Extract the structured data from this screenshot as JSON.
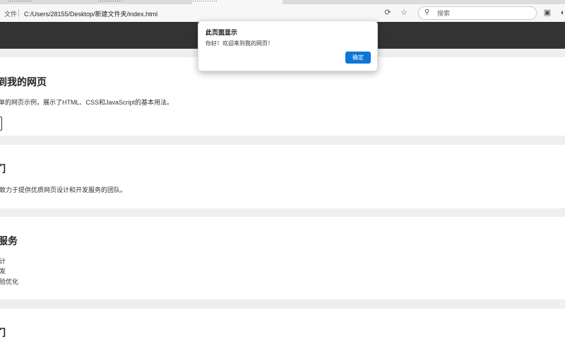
{
  "browser": {
    "tabs": [
      {
        "label": "…………"
      },
      {
        "label": "…………"
      },
      {
        "label": "…………"
      }
    ],
    "file_label": "文件",
    "url": "C:/Users/28155/Desktop/新建文件夹/index.html",
    "search_placeholder": "搜索",
    "icons": {
      "tracking": "tracking-icon",
      "favorite": "star-icon",
      "search": "search-icon",
      "collections": "collections-icon",
      "more": "more-icon"
    }
  },
  "page": {
    "header_color": "#333333",
    "sections": [
      {
        "title": "到我的网页",
        "text": "单的网页示例，展示了HTML、CSS和JavaScript的基本用法。"
      },
      {
        "title": "们",
        "text": "致力于提供优质网页设计和开发服务的团队。"
      },
      {
        "title": "服务",
        "items": [
          "计",
          "发",
          "验优化"
        ]
      },
      {
        "title": "们"
      }
    ]
  },
  "dialog": {
    "title": "此页面显示",
    "message": "你好！欢迎来到我的网页！",
    "ok_label": "确定",
    "ok_color": "#0b77d6"
  }
}
